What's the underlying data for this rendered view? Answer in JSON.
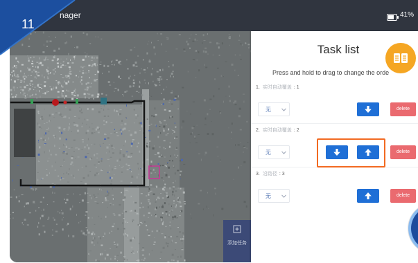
{
  "badge": {
    "number": "11"
  },
  "topbar": {
    "title": "nager",
    "battery_icon": "battery-icon",
    "battery_level": "41%"
  },
  "map": {
    "add_task_icon": "add-task-icon",
    "add_task_label": "添加任务"
  },
  "panel": {
    "title": "Task list",
    "manual_icon": "book-icon",
    "hint": "Press and hold to drag to change the orde",
    "tasks": [
      {
        "number": "1.",
        "name": "实时自动覆盖",
        "suffix": ": 1",
        "mode": "无",
        "controls": [
          "arrow-down-icon"
        ],
        "delete_label": "delete"
      },
      {
        "number": "2.",
        "name": "实时自动覆盖",
        "suffix": ": 2",
        "mode": "无",
        "controls": [
          "arrow-down-icon",
          "arrow-up-icon"
        ],
        "delete_label": "delete",
        "highlighted": true
      },
      {
        "number": "3.",
        "name": "沿路径",
        "suffix": ": 3",
        "mode": "无",
        "controls": [
          "arrow-up-icon"
        ],
        "delete_label": "delete"
      }
    ],
    "fab_icon": "round-action-icon"
  },
  "colors": {
    "topbar": "#30353f",
    "badge_blue": "#1c4f9f",
    "accent_blue": "#1f6fd6",
    "delete_red": "#ea6a6f",
    "highlight_orange": "#f26a21",
    "manual_orange": "#f5a623"
  }
}
